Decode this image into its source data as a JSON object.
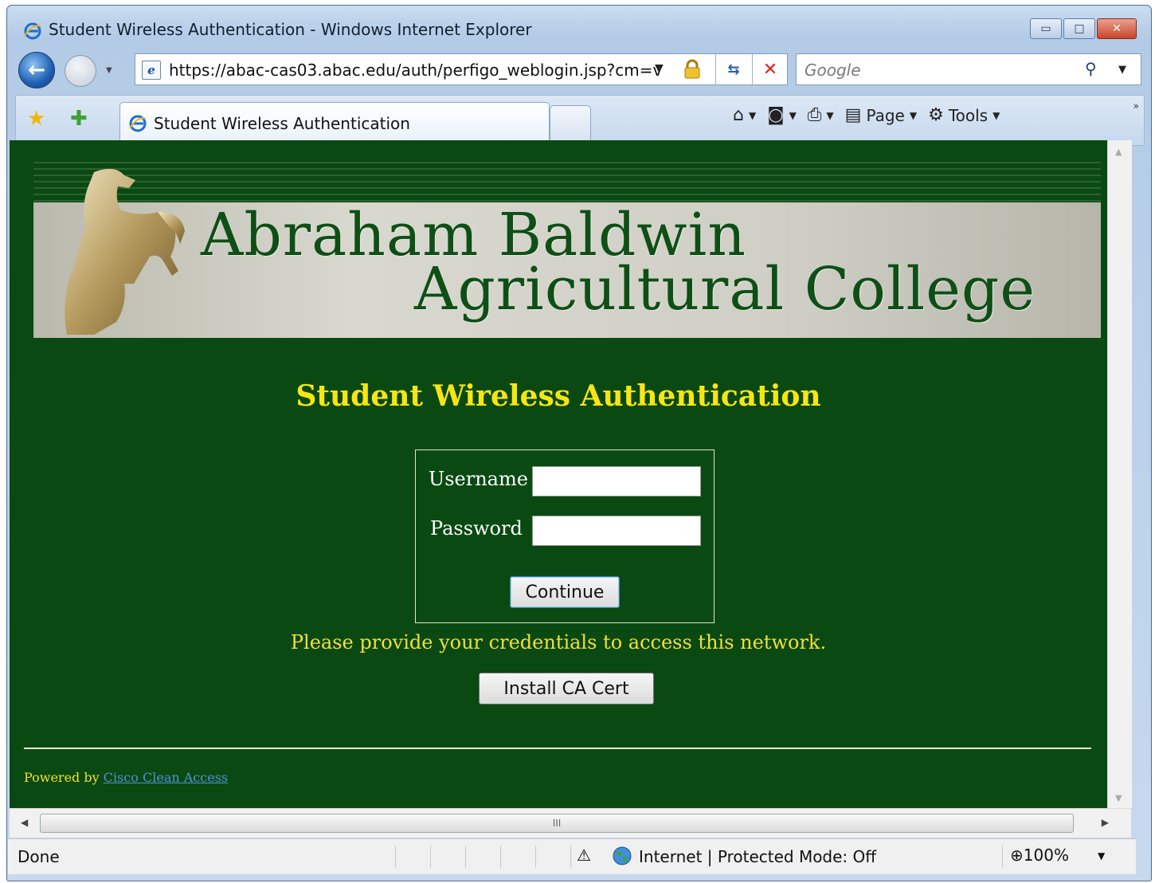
{
  "window": {
    "title": "Student Wireless Authentication - Windows Internet Explorer",
    "controls": {
      "minimize": "▭",
      "maximize": "□",
      "close": "✕"
    }
  },
  "navbar": {
    "address": "https://abac-cas03.abac.edu/auth/perfigo_weblogin.jsp?cm=v",
    "search_placeholder": "Google"
  },
  "tabbar": {
    "tab_label": "Student Wireless Authentication",
    "commands": {
      "page": "Page",
      "tools": "Tools"
    }
  },
  "page": {
    "banner_line1": "Abraham  Baldwin",
    "banner_line2": "Agricultural  College",
    "heading": "Student Wireless Authentication",
    "username_label": "Username",
    "password_label": "Password",
    "continue_label": "Continue",
    "message": "Please provide your credentials to access this network.",
    "install_cert_label": "Install CA Cert",
    "powered_by": "Powered by",
    "powered_link": "Cisco Clean Access"
  },
  "hscroll": {
    "grip": "III"
  },
  "statusbar": {
    "status": "Done",
    "zone": "Internet | Protected Mode: Off",
    "zoom": "100%"
  },
  "icons": [
    "ie-logo-icon",
    "back-icon",
    "forward-icon",
    "lock-icon",
    "refresh-icon",
    "stop-icon",
    "search-icon",
    "favorites-star-icon",
    "add-favorites-icon",
    "home-icon",
    "feeds-icon",
    "print-icon",
    "page-icon",
    "tools-gear-icon",
    "globe-icon",
    "zoom-icon"
  ],
  "colors": {
    "page_bg": "#0a4a12",
    "heading": "#f7e514",
    "banner_text": "#0e4f16"
  }
}
